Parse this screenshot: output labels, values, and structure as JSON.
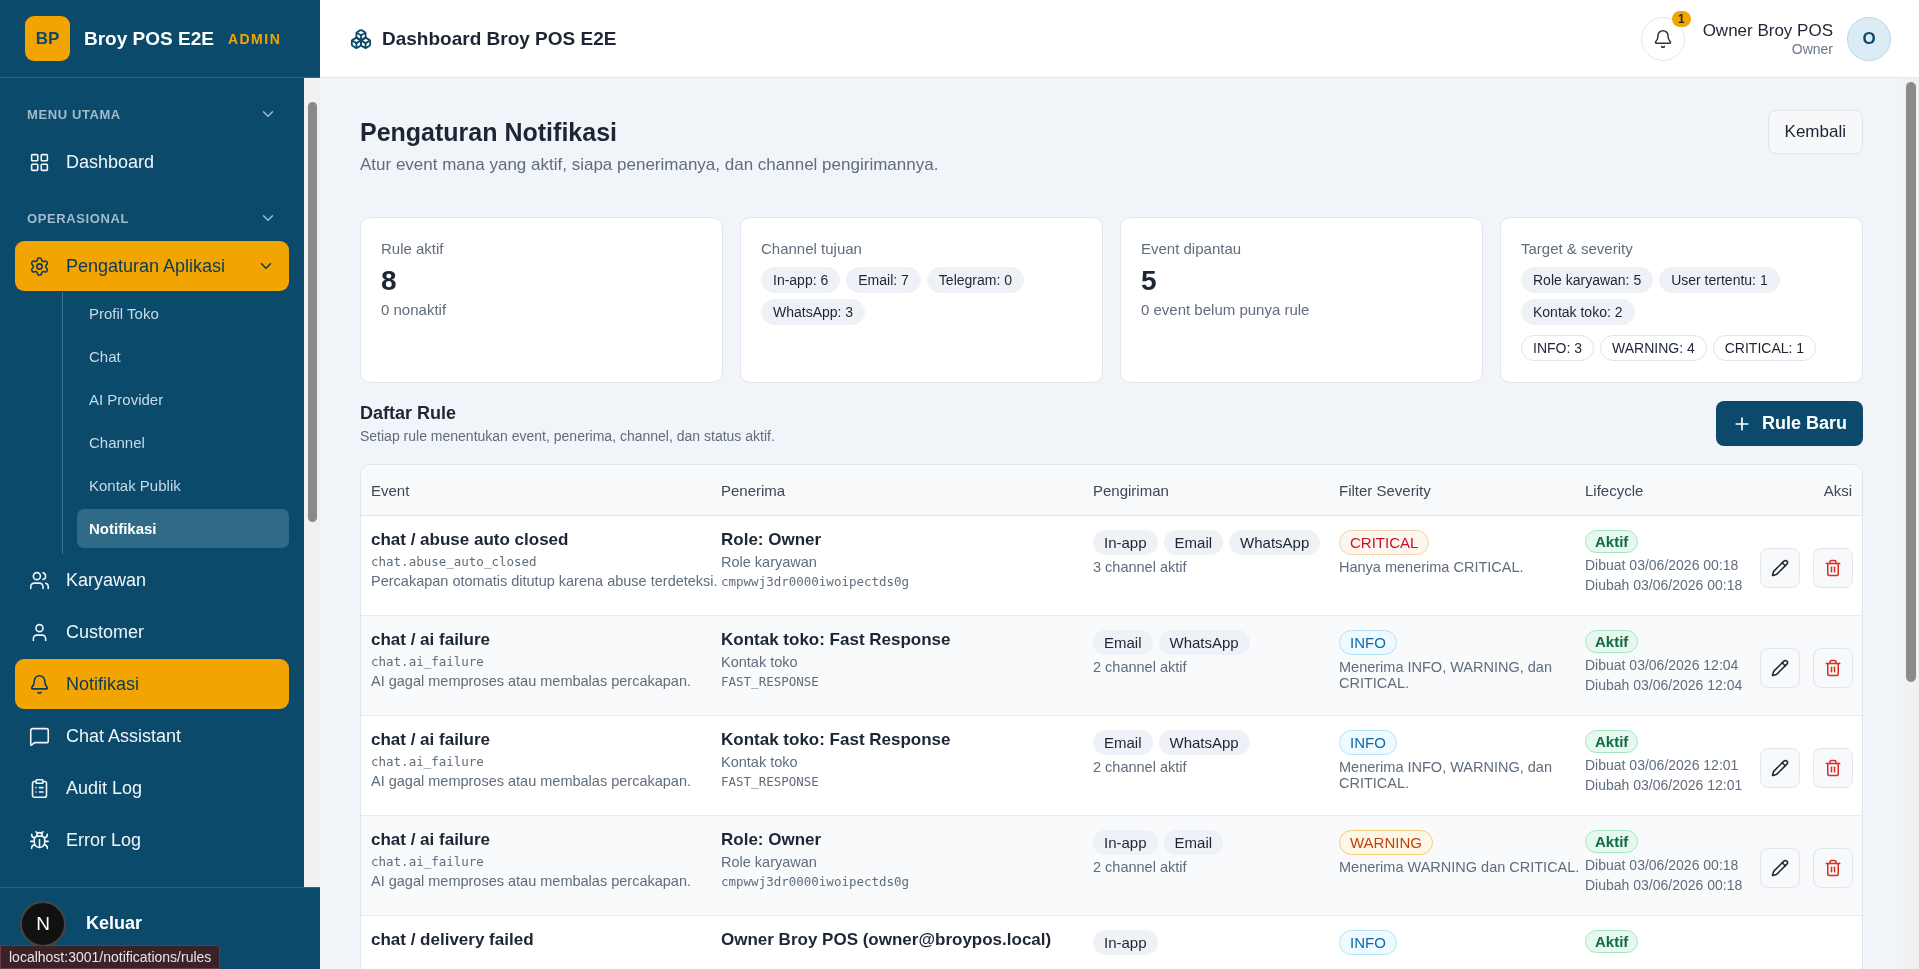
{
  "sidebar": {
    "brand": {
      "logo": "BP",
      "name": "Broy POS E2E",
      "badge": "ADMIN"
    },
    "sections": [
      {
        "label": "MENU UTAMA",
        "expanded": true,
        "items": [
          {
            "label": "Dashboard",
            "selected": false
          }
        ]
      },
      {
        "label": "OPERASIONAL",
        "expanded": true,
        "items": [
          {
            "label": "Pengaturan Aplikasi",
            "selected": true,
            "expanded": true,
            "children": [
              {
                "label": "Profil Toko",
                "selected": false
              },
              {
                "label": "Chat",
                "selected": false
              },
              {
                "label": "AI Provider",
                "selected": false
              },
              {
                "label": "Channel",
                "selected": false
              },
              {
                "label": "Kontak Publik",
                "selected": false
              },
              {
                "label": "Notifikasi",
                "selected": true
              }
            ]
          },
          {
            "label": "Karyawan",
            "selected": false
          },
          {
            "label": "Customer",
            "selected": false
          },
          {
            "label": "Notifikasi",
            "selected": true
          },
          {
            "label": "Chat Assistant",
            "selected": false
          },
          {
            "label": "Audit Log",
            "selected": false
          },
          {
            "label": "Error Log",
            "selected": false
          }
        ]
      }
    ],
    "footer": {
      "label": "Keluar",
      "dev_badge": "N"
    }
  },
  "header": {
    "title": "Dashboard Broy POS E2E",
    "notification_count": "1",
    "user": {
      "name": "Owner Broy POS",
      "role": "Owner",
      "initial": "O"
    }
  },
  "page": {
    "title": "Pengaturan Notifikasi",
    "subtitle": "Atur event mana yang aktif, siapa penerimanya, dan channel pengirimannya.",
    "back_button": "Kembali"
  },
  "stats": [
    {
      "kind": "number",
      "label": "Rule aktif",
      "value": "8",
      "note": "0 nonaktif"
    },
    {
      "kind": "chips",
      "label": "Channel tujuan",
      "groups": [
        [
          "In-app: 6",
          "Email: 7",
          "Telegram: 0",
          "WhatsApp: 3"
        ]
      ]
    },
    {
      "kind": "number",
      "label": "Event dipantau",
      "value": "5",
      "note": "0 event belum punya rule"
    },
    {
      "kind": "chips",
      "label": "Target & severity",
      "groups": [
        [
          "Role karyawan: 5",
          "User tertentu: 1",
          "Kontak toko: 2"
        ],
        [
          "INFO: 3",
          "WARNING: 4",
          "CRITICAL: 1"
        ]
      ]
    }
  ],
  "rules": {
    "title": "Daftar Rule",
    "subtitle": "Setiap rule menentukan event, penerima, channel, dan status aktif.",
    "new_button": "Rule Baru",
    "columns": [
      "Event",
      "Penerima",
      "Pengiriman",
      "Filter Severity",
      "Lifecycle",
      "Aksi"
    ],
    "rows": [
      {
        "event": "chat / abuse auto closed",
        "code": "chat.abuse_auto_closed",
        "description": "Percakapan otomatis ditutup karena abuse terdeteksi.",
        "recipient": "Role: Owner",
        "recipient_type": "Role karyawan",
        "recipient_id": "cmpwwj3dr0000iwoipectds0g",
        "channels": [
          "In-app",
          "Email",
          "WhatsApp"
        ],
        "channel_note": "3 channel aktif",
        "severity": {
          "label": "CRITICAL",
          "kind": "critical"
        },
        "severity_note": "Hanya menerima CRITICAL.",
        "status": "Aktif",
        "active": true,
        "created": "Dibuat 03/06/2026 00:18",
        "updated": "Diubah 03/06/2026 00:18"
      },
      {
        "event": "chat / ai failure",
        "code": "chat.ai_failure",
        "description": "AI gagal memproses atau membalas percakapan.",
        "recipient": "Kontak toko: Fast Response",
        "recipient_type": "Kontak toko",
        "recipient_id": "FAST_RESPONSE",
        "channels": [
          "Email",
          "WhatsApp"
        ],
        "channel_note": "2 channel aktif",
        "severity": {
          "label": "INFO",
          "kind": "info"
        },
        "severity_note": "Menerima INFO, WARNING, dan CRITICAL.",
        "status": "Aktif",
        "active": true,
        "created": "Dibuat 03/06/2026 12:04",
        "updated": "Diubah 03/06/2026 12:04"
      },
      {
        "event": "chat / ai failure",
        "code": "chat.ai_failure",
        "description": "AI gagal memproses atau membalas percakapan.",
        "recipient": "Kontak toko: Fast Response",
        "recipient_type": "Kontak toko",
        "recipient_id": "FAST_RESPONSE",
        "channels": [
          "Email",
          "WhatsApp"
        ],
        "channel_note": "2 channel aktif",
        "severity": {
          "label": "INFO",
          "kind": "info"
        },
        "severity_note": "Menerima INFO, WARNING, dan CRITICAL.",
        "status": "Aktif",
        "active": true,
        "created": "Dibuat 03/06/2026 12:01",
        "updated": "Diubah 03/06/2026 12:01"
      },
      {
        "event": "chat / ai failure",
        "code": "chat.ai_failure",
        "description": "AI gagal memproses atau membalas percakapan.",
        "recipient": "Role: Owner",
        "recipient_type": "Role karyawan",
        "recipient_id": "cmpwwj3dr0000iwoipectds0g",
        "channels": [
          "In-app",
          "Email"
        ],
        "channel_note": "2 channel aktif",
        "severity": {
          "label": "WARNING",
          "kind": "warning"
        },
        "severity_note": "Menerima WARNING dan CRITICAL.",
        "status": "Aktif",
        "active": true,
        "created": "Dibuat 03/06/2026 00:18",
        "updated": "Diubah 03/06/2026 00:18"
      },
      {
        "event": "chat / delivery failed",
        "recipient": "Owner Broy POS (owner@broypos.local)",
        "channels": [
          "In-app"
        ],
        "severity": {
          "label": "INFO",
          "kind": "info"
        },
        "status": "Aktif",
        "active": true
      }
    ]
  },
  "browser_status": "localhost:3001/notifications/rules"
}
